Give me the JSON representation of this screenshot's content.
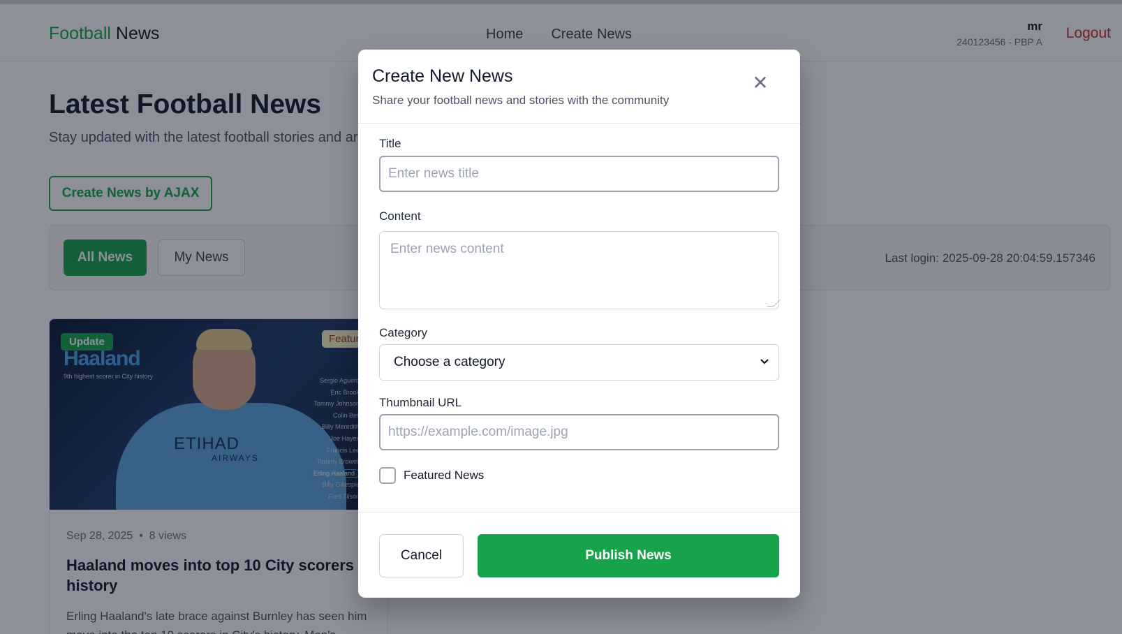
{
  "navbar": {
    "brand_part1": "Football",
    "brand_part2": " News",
    "links": [
      "Home",
      "Create News"
    ],
    "user_name": "mr",
    "user_id": "240123456 - PBP A",
    "logout_label": "Logout"
  },
  "main": {
    "title": "Latest Football News",
    "subtitle": "Stay updated with the latest football stories and ar",
    "ajax_button_label": "Create News by AJAX",
    "filters": {
      "all_news_label": "All News",
      "my_news_label": "My News",
      "last_login": "Last login: 2025-09-28 20:04:59.157346"
    }
  },
  "card": {
    "badge_category": "Update",
    "badge_featured": "Featur",
    "image_text": {
      "headline": "Haaland",
      "caption": "9th highest scorer in City history",
      "sponsor": "ETIHAD",
      "sponsor_sub": "AIRWAYS",
      "scorers": [
        "Sergio Aguero",
        "Eric Brook",
        "Tommy Johnson",
        "Colin Bell",
        "Billy Meredith",
        "Joe Hayes",
        "Francis Lee",
        "Tommy Browell",
        "Erling Haaland",
        "Billy Gillespie",
        "Fred Tilson"
      ]
    },
    "meta_date": "Sep 28, 2025",
    "meta_separator": "•",
    "meta_views": "8 views",
    "title": "Haaland moves into top 10 City scorers in history",
    "excerpt": "Erling Haaland's late brace against Burnley has seen him move into the top 10 scorers in City's history. Man's"
  },
  "modal": {
    "title": "Create New News",
    "subtitle": "Share your football news and stories with the community",
    "close_glyph": "✕",
    "fields": {
      "title_label": "Title",
      "title_placeholder": "Enter news title",
      "content_label": "Content",
      "content_placeholder": "Enter news content",
      "category_label": "Category",
      "category_selected": "Choose a category",
      "thumbnail_label": "Thumbnail URL",
      "thumbnail_placeholder": "https://example.com/image.jpg",
      "featured_label": "Featured News"
    },
    "cancel_label": "Cancel",
    "publish_label": "Publish News"
  },
  "colors": {
    "brand_green": "#16a34a",
    "logout_red": "#dc2626",
    "overlay": "rgba(17,24,39,0.48)"
  },
  "icons": {
    "close": "close-icon",
    "select_chevron": "chevron-down-icon",
    "resize": "resize-grip-icon"
  }
}
